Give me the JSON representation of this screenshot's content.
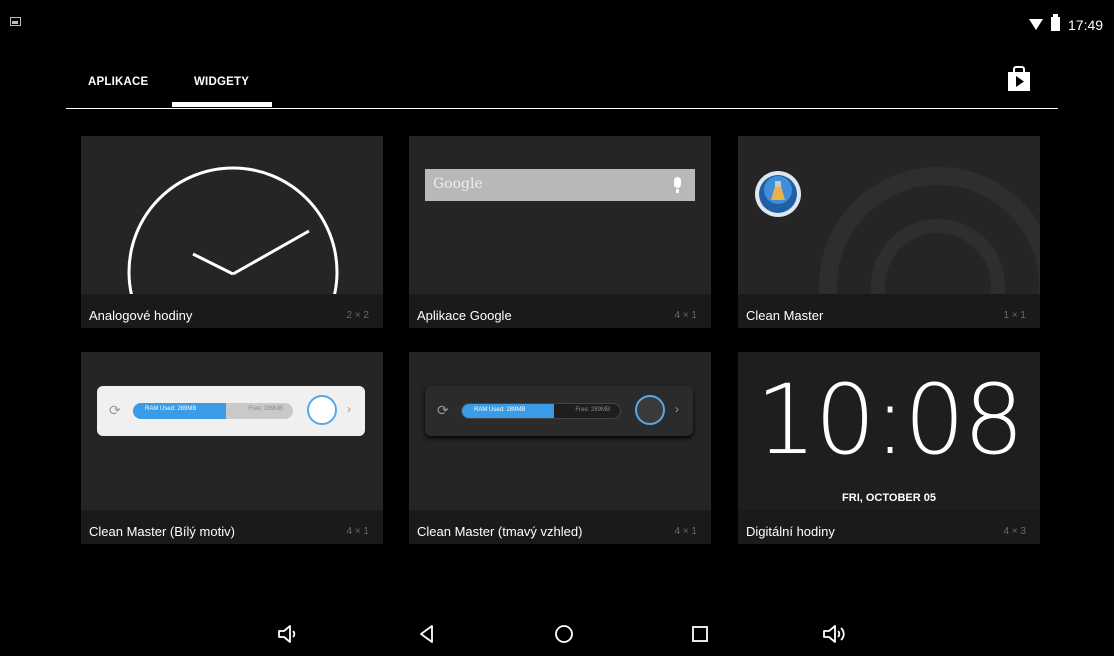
{
  "status_bar": {
    "time": "17:49"
  },
  "tabs": [
    {
      "label": "APLIKACE",
      "active": false
    },
    {
      "label": "WIDGETY",
      "active": true
    }
  ],
  "widgets": [
    {
      "name": "Analogové hodiny",
      "size": "2 × 2"
    },
    {
      "name": "Aplikace Google",
      "size": "4 × 1",
      "preview_text": "Google"
    },
    {
      "name": "Clean Master",
      "size": "1 × 1"
    },
    {
      "name": "Clean Master (Bílý motiv)",
      "size": "4 × 1",
      "ram_used": "RAM Used: 289MB",
      "free": "Free: 289MB"
    },
    {
      "name": "Clean Master (tmavý vzhled)",
      "size": "4 × 1",
      "ram_used": "RAM Used: 289MB",
      "free": "Free: 289MB"
    },
    {
      "name": "Digitální hodiny",
      "size": "4 × 3",
      "clock": "10:08",
      "date": "FRI, OCTOBER 05"
    }
  ],
  "icons": {
    "store": "play-store-icon",
    "nav": [
      "volume-down-icon",
      "back-icon",
      "home-icon",
      "recents-icon",
      "volume-up-icon"
    ]
  }
}
